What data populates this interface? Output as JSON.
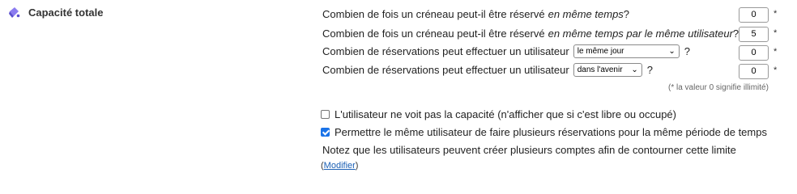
{
  "section": {
    "title": "Capacité totale",
    "icon": "paint-bucket-icon",
    "icon_color": "#7b68ee"
  },
  "rows": [
    {
      "text_before": "Combien de fois un créneau peut-il être réservé ",
      "text_italic": "en même temps",
      "text_after": " ?",
      "value": "0",
      "required": "*"
    },
    {
      "text_before": "Combien de fois un créneau peut-il être réservé ",
      "text_italic": "en même temps par le même utilisateur",
      "text_after": " ?",
      "value": "5",
      "required": "*"
    },
    {
      "text_before": "Combien de réservations peut effectuer un utilisateur",
      "select_value": "le même jour",
      "text_after": "?",
      "value": "0",
      "required": "*"
    },
    {
      "text_before": "Combien de réservations peut effectuer un utilisateur",
      "select_value": "dans l'avenir",
      "text_after": "?",
      "value": "0",
      "required": "*"
    }
  ],
  "hint": "(* la valeur 0 signifie illimité)",
  "options": [
    {
      "label": "L'utilisateur ne voit pas la capacité (n'afficher que si c'est libre ou occupé)",
      "checked": false
    },
    {
      "label": "Permettre le même utilisateur de faire plusieurs réservations pour la même période de temps",
      "checked": true
    }
  ],
  "note": "Notez que les utilisateurs peuvent créer plusieurs comptes afin de contourner cette limite",
  "modify": {
    "open": "(",
    "link": "Modifier",
    "close": ")"
  },
  "colors": {
    "accent": "#1a73e8",
    "link": "#1a5fb4"
  }
}
